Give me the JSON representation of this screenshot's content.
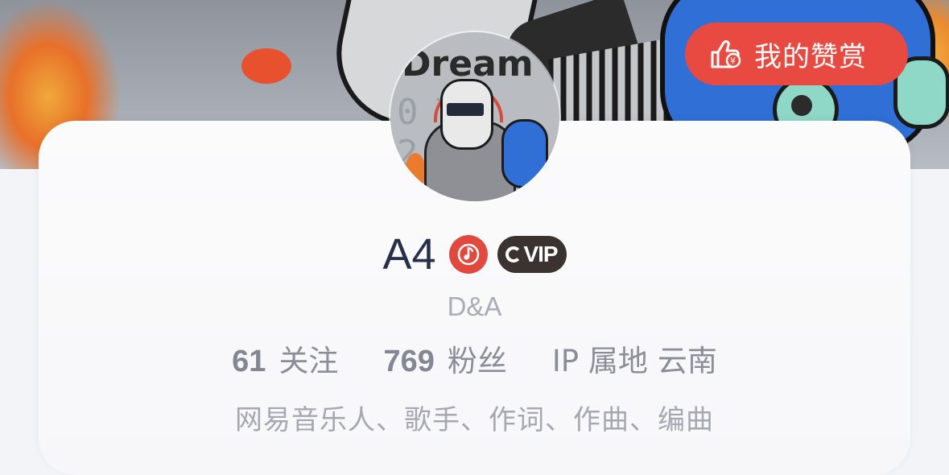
{
  "header": {
    "reward_button": {
      "label": "我的赞赏",
      "icon": "thumbs-up-yuan-icon"
    }
  },
  "profile": {
    "name": "A4",
    "badges": {
      "music": "music-note-icon",
      "vip_label": "VIP"
    },
    "nickname": "D&A",
    "stats": {
      "follow_count": "61",
      "follow_label": "关注",
      "fans_count": "769",
      "fans_label": "粉丝",
      "ip_label": "IP 属地",
      "ip_location": "云南"
    },
    "tags": "网易音乐人、歌手、作词、作曲、编曲",
    "avatar_text": "Dream",
    "avatar_date": "07 22"
  },
  "colors": {
    "accent": "#e84a42",
    "name": "#27304a",
    "muted": "#a9adb6",
    "vip_bg": "#3b3330"
  }
}
